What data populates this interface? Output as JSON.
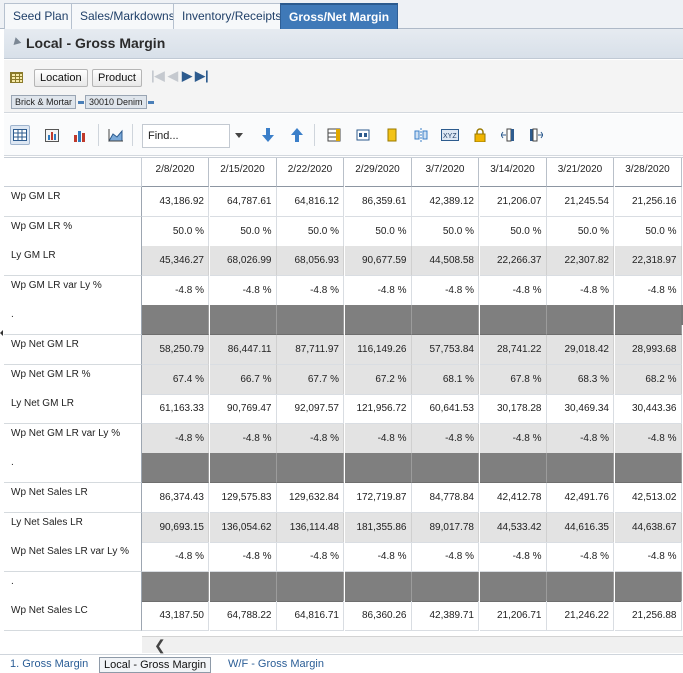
{
  "top_tabs": [
    "Seed Plan",
    "Sales/Markdowns",
    "Inventory/Receipts",
    "Gross/Net Margin"
  ],
  "active_top_tab": "Gross/Net Margin",
  "panel": {
    "title": "Local - Gross Margin"
  },
  "dimensions": {
    "location_label": "Location",
    "product_label": "Product"
  },
  "breadcrumbs": [
    "Brick & Mortar",
    "30010 Denim"
  ],
  "toolbar": {
    "find_placeholder": "Find..."
  },
  "grid": {
    "columns": [
      "2/8/2020",
      "2/15/2020",
      "2/22/2020",
      "2/29/2020",
      "3/7/2020",
      "3/14/2020",
      "3/21/2020",
      "3/28/2020"
    ],
    "rows": [
      {
        "label": "Wp GM LR",
        "style": "normal",
        "values": [
          "43,186.92",
          "64,787.61",
          "64,816.12",
          "86,359.61",
          "42,389.12",
          "21,206.07",
          "21,245.54",
          "21,256.16"
        ]
      },
      {
        "label": "Wp GM LR %",
        "style": "normal",
        "values": [
          "50.0 %",
          "50.0 %",
          "50.0 %",
          "50.0 %",
          "50.0 %",
          "50.0 %",
          "50.0 %",
          "50.0 %"
        ]
      },
      {
        "label": "Ly GM LR",
        "style": "alt",
        "values": [
          "45,346.27",
          "68,026.99",
          "68,056.93",
          "90,677.59",
          "44,508.58",
          "22,266.37",
          "22,307.82",
          "22,318.97"
        ]
      },
      {
        "label": "Wp GM LR var Ly %",
        "style": "normal",
        "values": [
          "-4.8 %",
          "-4.8 %",
          "-4.8 %",
          "-4.8 %",
          "-4.8 %",
          "-4.8 %",
          "-4.8 %",
          "-4.8 %"
        ]
      },
      {
        "label": ".",
        "style": "sep",
        "values": [
          "",
          "",
          "",
          "",
          "",
          "",
          "",
          ""
        ]
      },
      {
        "label": "Wp Net GM LR",
        "style": "alt",
        "values": [
          "58,250.79",
          "86,447.11",
          "87,711.97",
          "116,149.26",
          "57,753.84",
          "28,741.22",
          "29,018.42",
          "28,993.68"
        ]
      },
      {
        "label": "Wp Net GM LR %",
        "style": "alt",
        "values": [
          "67.4 %",
          "66.7 %",
          "67.7 %",
          "67.2 %",
          "68.1 %",
          "67.8 %",
          "68.3 %",
          "68.2 %"
        ]
      },
      {
        "label": "Ly Net GM LR",
        "style": "normal",
        "values": [
          "61,163.33",
          "90,769.47",
          "92,097.57",
          "121,956.72",
          "60,641.53",
          "30,178.28",
          "30,469.34",
          "30,443.36"
        ]
      },
      {
        "label": "Wp Net GM LR var Ly %",
        "style": "alt",
        "values": [
          "-4.8 %",
          "-4.8 %",
          "-4.8 %",
          "-4.8 %",
          "-4.8 %",
          "-4.8 %",
          "-4.8 %",
          "-4.8 %"
        ]
      },
      {
        "label": ".",
        "style": "sep",
        "values": [
          "",
          "",
          "",
          "",
          "",
          "",
          "",
          ""
        ]
      },
      {
        "label": "Wp Net Sales LR",
        "style": "normal",
        "values": [
          "86,374.43",
          "129,575.83",
          "129,632.84",
          "172,719.87",
          "84,778.84",
          "42,412.78",
          "42,491.76",
          "42,513.02"
        ]
      },
      {
        "label": "Ly Net Sales LR",
        "style": "alt",
        "values": [
          "90,693.15",
          "136,054.62",
          "136,114.48",
          "181,355.86",
          "89,017.78",
          "44,533.42",
          "44,616.35",
          "44,638.67"
        ]
      },
      {
        "label": "Wp Net Sales LR var Ly %",
        "style": "normal",
        "values": [
          "-4.8 %",
          "-4.8 %",
          "-4.8 %",
          "-4.8 %",
          "-4.8 %",
          "-4.8 %",
          "-4.8 %",
          "-4.8 %"
        ]
      },
      {
        "label": ".",
        "style": "sep",
        "values": [
          "",
          "",
          "",
          "",
          "",
          "",
          "",
          ""
        ]
      },
      {
        "label": "Wp Net Sales LC",
        "style": "normal",
        "values": [
          "43,187.50",
          "64,788.22",
          "64,816.71",
          "86,360.26",
          "42,389.71",
          "21,206.71",
          "21,246.22",
          "21,256.88"
        ]
      }
    ]
  },
  "bottom_tabs": [
    "1. Gross Margin",
    "Local - Gross Margin",
    "W/F - Gross Margin"
  ],
  "active_bottom_tab": "Local - Gross Margin"
}
